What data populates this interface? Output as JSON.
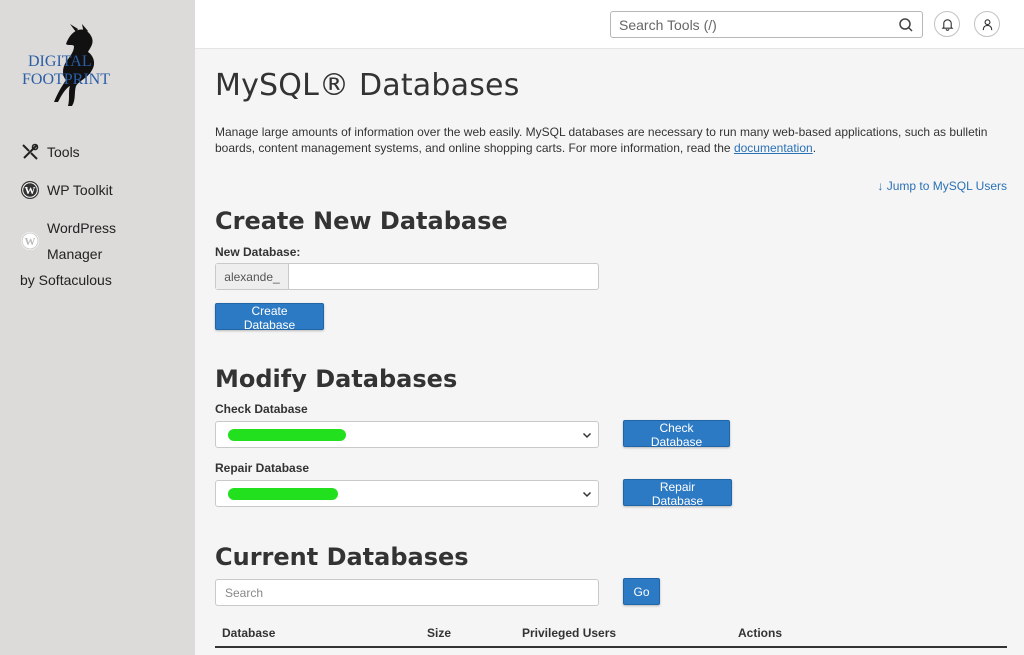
{
  "logo": {
    "line1": "DIGITAL",
    "line2": "FOOTPRINT"
  },
  "sidebar": {
    "items": [
      {
        "label": "Tools",
        "icon": "tools-icon"
      },
      {
        "label": "WP Toolkit",
        "icon": "wordpress-icon"
      },
      {
        "label": "WordPress Manager",
        "label2": "by Softaculous",
        "icon": "wordpress-icon"
      }
    ]
  },
  "topbar": {
    "search_placeholder": "Search Tools (/)"
  },
  "page": {
    "title": "MySQL® Databases",
    "intro_text": "Manage large amounts of information over the web easily. MySQL databases are necessary to run many web-based applications, such as bulletin boards, content management systems, and online shopping carts. For more information, read the ",
    "intro_link": "documentation",
    "intro_end": ".",
    "jump_link": "↓ Jump to MySQL Users"
  },
  "create": {
    "title": "Create New Database",
    "label": "New Database:",
    "prefix": "alexande_",
    "button": "Create Database"
  },
  "modify": {
    "title": "Modify Databases",
    "check_label": "Check Database",
    "check_button": "Check Database",
    "repair_label": "Repair Database",
    "repair_button": "Repair Database"
  },
  "current": {
    "title": "Current Databases",
    "search_placeholder": "Search",
    "go_button": "Go",
    "columns": [
      "Database",
      "Size",
      "Privileged Users",
      "Actions"
    ]
  },
  "colors": {
    "accent": "#2d7ac4",
    "sidebar_bg": "#dcdbd9",
    "redaction": "#22e01e"
  }
}
